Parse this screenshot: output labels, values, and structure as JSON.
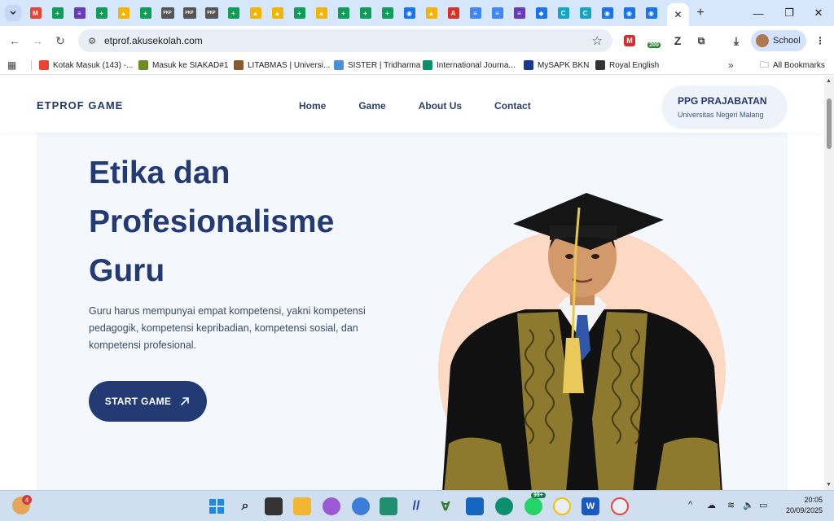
{
  "browser": {
    "tab_favicons": [
      {
        "name": "tab-gmail",
        "color": "#ea4335",
        "glyph": "M"
      },
      {
        "name": "tab-sheets",
        "color": "#0f9d58",
        "glyph": "+"
      },
      {
        "name": "tab-forms",
        "color": "#673ab7",
        "glyph": "≡"
      },
      {
        "name": "tab-sheets",
        "color": "#0f9d58",
        "glyph": "+"
      },
      {
        "name": "tab-drive",
        "color": "#f4b400",
        "glyph": "▲"
      },
      {
        "name": "tab-sheets",
        "color": "#0f9d58",
        "glyph": "+"
      },
      {
        "name": "tab-pkp",
        "color": "#555555",
        "glyph": "PKP"
      },
      {
        "name": "tab-pkp",
        "color": "#555555",
        "glyph": "PKP"
      },
      {
        "name": "tab-pkp",
        "color": "#555555",
        "glyph": "PKP"
      },
      {
        "name": "tab-sheets",
        "color": "#0f9d58",
        "glyph": "+"
      },
      {
        "name": "tab-drive",
        "color": "#f4b400",
        "glyph": "▲"
      },
      {
        "name": "tab-drive",
        "color": "#f4b400",
        "glyph": "▲"
      },
      {
        "name": "tab-sheets",
        "color": "#0f9d58",
        "glyph": "+"
      },
      {
        "name": "tab-drive",
        "color": "#f4b400",
        "glyph": "▲"
      },
      {
        "name": "tab-sheets",
        "color": "#0f9d58",
        "glyph": "+"
      },
      {
        "name": "tab-sheets",
        "color": "#0f9d58",
        "glyph": "+"
      },
      {
        "name": "tab-sheets",
        "color": "#0f9d58",
        "glyph": "+"
      },
      {
        "name": "tab-edu",
        "color": "#1a73e8",
        "glyph": "◉"
      },
      {
        "name": "tab-drive",
        "color": "#f4b400",
        "glyph": "▲"
      },
      {
        "name": "tab-pdf",
        "color": "#d93025",
        "glyph": "A"
      },
      {
        "name": "tab-docs",
        "color": "#4285f4",
        "glyph": "≡"
      },
      {
        "name": "tab-docs",
        "color": "#4285f4",
        "glyph": "≡"
      },
      {
        "name": "tab-forms",
        "color": "#673ab7",
        "glyph": "≡"
      },
      {
        "name": "tab-classroom",
        "color": "#1a73e8",
        "glyph": "◆"
      },
      {
        "name": "tab-canva",
        "color": "#12a5c9",
        "glyph": "C"
      },
      {
        "name": "tab-canva",
        "color": "#12a5c9",
        "glyph": "C"
      },
      {
        "name": "tab-edu",
        "color": "#1a73e8",
        "glyph": "◉"
      },
      {
        "name": "tab-edu",
        "color": "#1a73e8",
        "glyph": "◉"
      },
      {
        "name": "tab-edu",
        "color": "#1a73e8",
        "glyph": "◉"
      }
    ],
    "url": "etprof.akusekolah.com",
    "profile_label": "School",
    "extension_badge": "200",
    "bookmarks": [
      {
        "label": "Kotak Masuk (143) -...",
        "color": "#ea4335"
      },
      {
        "label": "Masuk ke SIAKAD#1",
        "color": "#6b8e23"
      },
      {
        "label": "LITABMAS | Universi...",
        "color": "#8b5a2b"
      },
      {
        "label": "SISTER | Tridharma",
        "color": "#4a90d9"
      },
      {
        "label": "International Journa...",
        "color": "#0b8f6e"
      },
      {
        "label": "MySAPK BKN",
        "color": "#1a3a8f"
      },
      {
        "label": "Royal English",
        "color": "#333333"
      }
    ],
    "all_bookmarks_label": "All Bookmarks"
  },
  "site": {
    "logo": "ETPROF GAME",
    "nav": [
      "Home",
      "Game",
      "About Us",
      "Contact"
    ],
    "ppg_title": "PPG PRAJABATAN",
    "ppg_subtitle": "Universitas Negeri Malang"
  },
  "hero": {
    "title_line1": "Etika dan",
    "title_line2": "Profesionalisme",
    "title_line3": "Guru",
    "description": "Guru harus mempunyai empat kompetensi, yakni kompetensi pedagogik, kompetensi kepribadian, kompetensi sosial, dan kompetensi profesional.",
    "button_label": "START GAME"
  },
  "colors": {
    "brand_navy": "#233a73",
    "hero_bg": "#f4f7fc",
    "circle_peach": "#fbd9c4"
  },
  "taskbar": {
    "widget_badge": "4",
    "whatsapp_badge": "99+",
    "time": "20:05",
    "date": "20/09/2025"
  }
}
